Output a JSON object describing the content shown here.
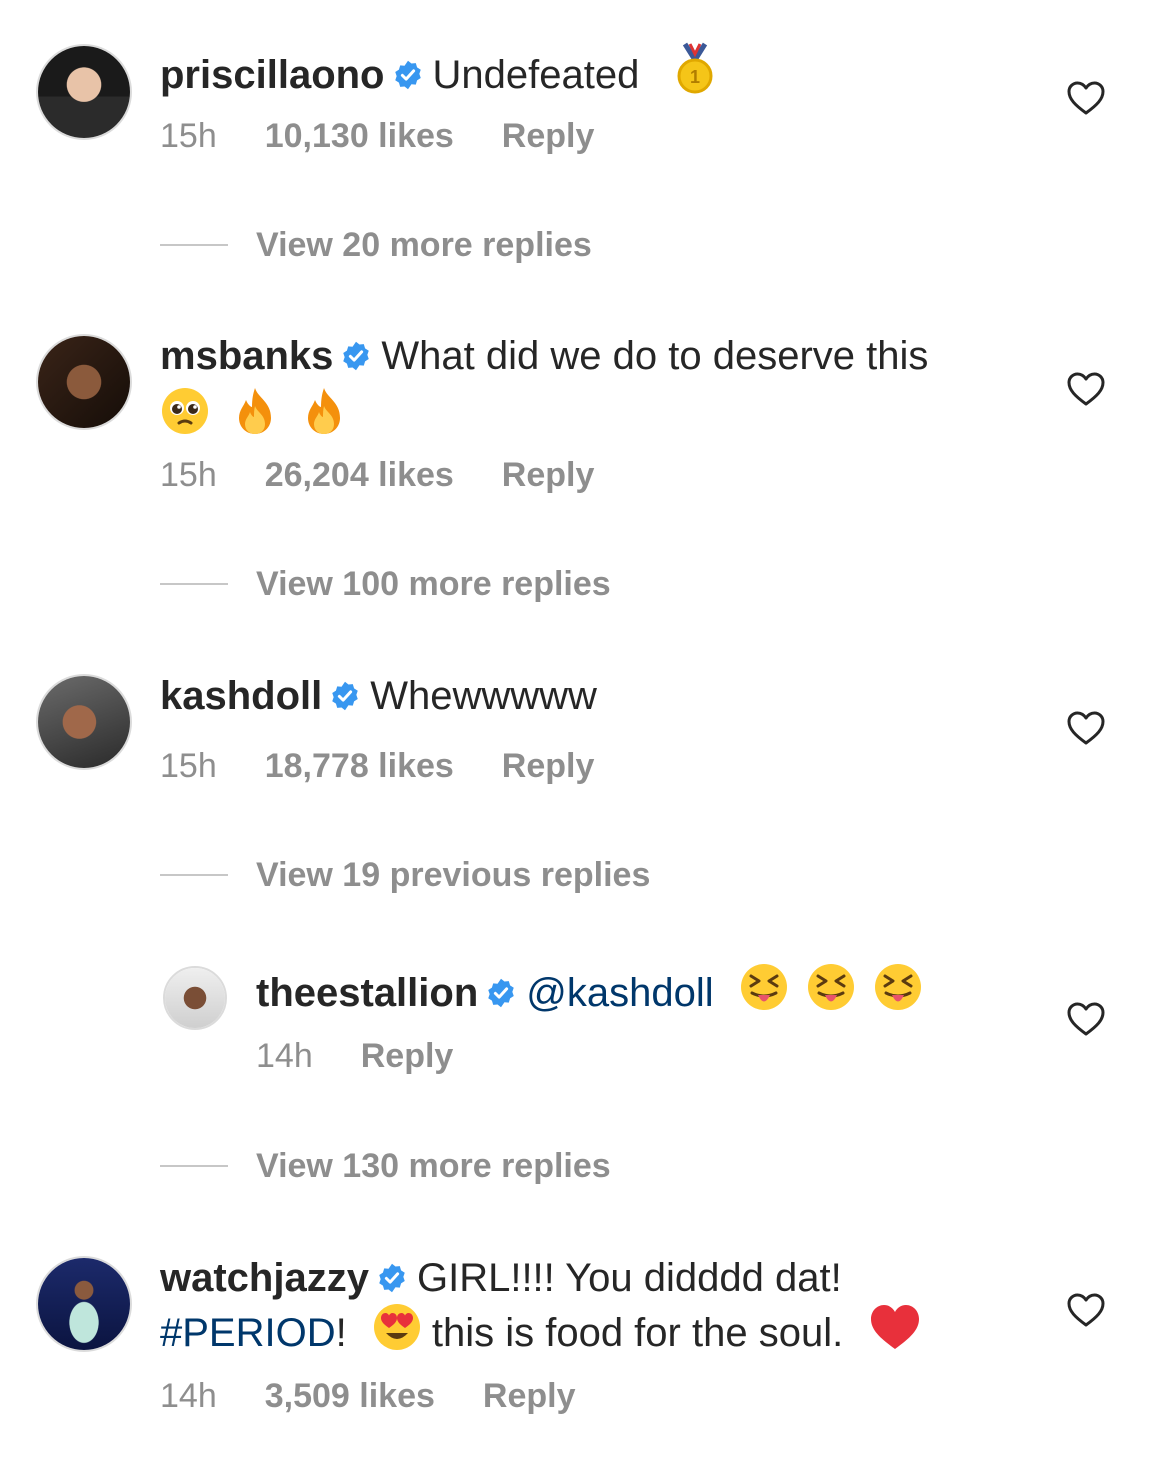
{
  "comments": [
    {
      "username": "priscillaono",
      "text": "Undefeated",
      "time": "15h",
      "likes": "10,130 likes",
      "reply": "Reply",
      "view_more": "View 20 more replies"
    },
    {
      "username": "msbanks",
      "text": "What did we do to deserve this",
      "time": "15h",
      "likes": "26,204 likes",
      "reply": "Reply",
      "view_more": "View 100 more replies"
    },
    {
      "username": "kashdoll",
      "text": "Whewwwww",
      "time": "15h",
      "likes": "18,778 likes",
      "reply": "Reply",
      "view_more": "View 19 previous replies"
    },
    {
      "username": "theestallion",
      "mention": "@kashdoll",
      "time": "14h",
      "reply": "Reply",
      "view_more": "View 130 more replies"
    },
    {
      "username": "watchjazzy",
      "text1": "GIRL!!!! You didddd dat!",
      "hashtag": "#PERIOD",
      "text2": "!",
      "text3": "this is food for the soul.",
      "time": "14h",
      "likes": "3,509 likes",
      "reply": "Reply"
    }
  ],
  "icons": {
    "verified": "verified-badge-icon",
    "heart": "heart-outline-icon",
    "medal": "gold-medal-emoji",
    "pleading": "pleading-face-emoji",
    "fire": "fire-emoji",
    "tongue": "squinting-tongue-face-emoji",
    "heart_eyes": "heart-eyes-emoji",
    "red_heart": "red-heart-emoji"
  },
  "colors": {
    "link": "#00376b",
    "verified": "#3897f0",
    "secondary_text": "#8e8e8e"
  }
}
